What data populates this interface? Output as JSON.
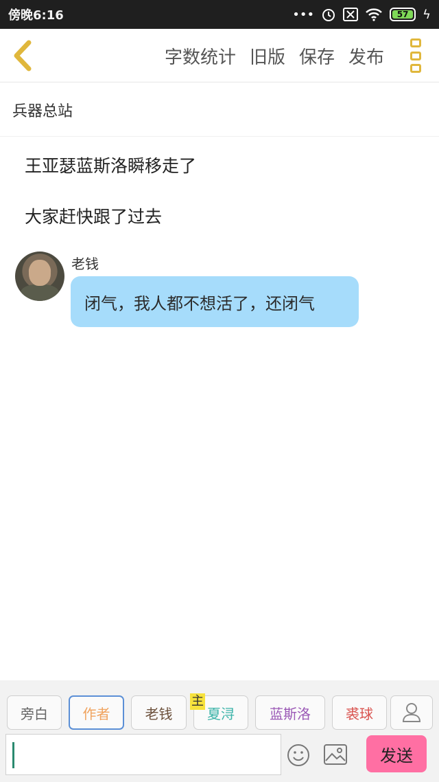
{
  "status_bar": {
    "time": "傍晚6:16",
    "battery": "57",
    "icons": [
      "more-dots-icon",
      "alarm-icon",
      "sim-off-icon",
      "wifi-icon",
      "battery-icon",
      "charging-icon"
    ]
  },
  "toolbar": {
    "back_icon": "back-chevron-icon",
    "actions": [
      "字数统计",
      "旧版",
      "保存",
      "发布"
    ],
    "more_icon": "more-vertical-icon",
    "accent": "#e0b73c"
  },
  "chapter": {
    "title": "兵器总站"
  },
  "story": {
    "narration": [
      "王亚瑟蓝斯洛瞬移走了",
      "大家赶快跟了过去"
    ],
    "messages": [
      {
        "speaker": "老钱",
        "text": "闭气，我人都不想活了，还闭气",
        "bubble_color": "#a6dcfb"
      }
    ]
  },
  "roles": {
    "items": [
      {
        "label": "旁白",
        "color": "#666666"
      },
      {
        "label": "作者",
        "color": "#f0a35e",
        "selected": true
      },
      {
        "label": "老钱",
        "color": "#6b4f3a"
      },
      {
        "label": "夏浔",
        "color": "#3bb3a8",
        "badge": "主"
      },
      {
        "label": "蓝斯洛",
        "color": "#9b59b6"
      },
      {
        "label": "裘球",
        "color": "#d9534f"
      }
    ],
    "user_icon": "user-icon"
  },
  "composer": {
    "value": "",
    "emoji_icon": "emoji-icon",
    "image_icon": "image-icon",
    "send_label": "发送",
    "send_color": "#ff6fa3"
  }
}
